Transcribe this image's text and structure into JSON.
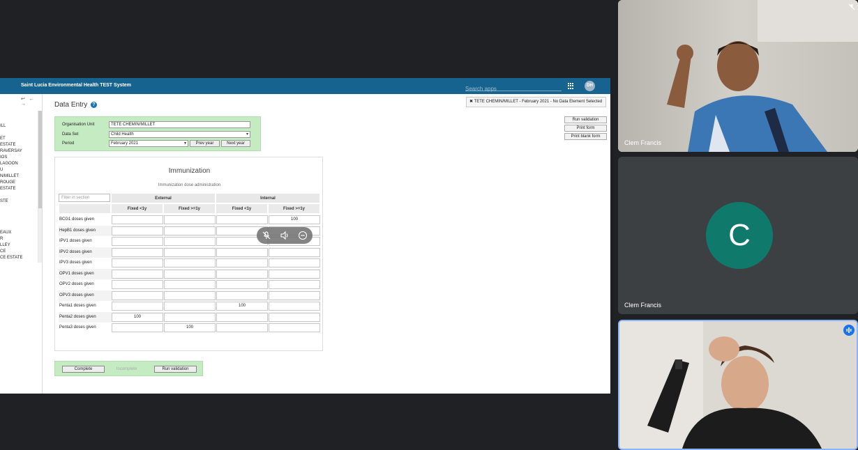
{
  "app": {
    "title": "Saint Lucia Environmental Health TEST System",
    "search_placeholder": "Search apps",
    "user_initials": "DH"
  },
  "tree": {
    "nav_arrows": "↩ ← →",
    "items": [
      "",
      "",
      "ILL",
      "",
      "ET",
      "ESTATE",
      "RAVERSAY",
      "IOS",
      "LAGOON",
      "U",
      "N/MILLET",
      "ROUGE",
      "ESTATE",
      "",
      "STE",
      "",
      "",
      "",
      "",
      "EAUX",
      "R",
      "LLEY",
      "CE",
      "CE ESTATE"
    ]
  },
  "page": {
    "title": "Data Entry",
    "help_glyph": "?",
    "selection_label": "✖ TETE CHEMIN/MILLET - February 2021 - No Data Element Selected"
  },
  "actions": {
    "run_validation": "Run validation",
    "print_form": "Print form",
    "print_blank_form": "Print blank form"
  },
  "org": {
    "org_unit_label": "Organisation Unit",
    "org_unit_value": "TETE CHEMIN/MILLET",
    "data_set_label": "Data Set",
    "data_set_value": "Child Health",
    "period_label": "Period",
    "period_value": "February 2021",
    "prev_year": "Prev year",
    "next_year": "Next year"
  },
  "section": {
    "title": "Immunization",
    "subtitle": "Immunization dose administration",
    "filter_placeholder": "Filter in section",
    "groups": [
      "External",
      "Internal"
    ],
    "columns": [
      "Fixed <1y",
      "Fixed >=1y",
      "Fixed <1y",
      "Fixed >=1y"
    ],
    "rows": [
      {
        "label": "BCG1 doses given",
        "values": [
          "",
          "",
          "",
          "100"
        ]
      },
      {
        "label": "HepB1 doses given",
        "values": [
          "",
          "",
          "",
          ""
        ]
      },
      {
        "label": "IPV1 doses given",
        "values": [
          "",
          "",
          "",
          ""
        ]
      },
      {
        "label": "IPV2 doses given",
        "values": [
          "",
          "",
          "",
          ""
        ]
      },
      {
        "label": "IPV3 doses given",
        "values": [
          "",
          "",
          "",
          ""
        ]
      },
      {
        "label": "OPV1 doses given",
        "values": [
          "",
          "",
          "",
          ""
        ]
      },
      {
        "label": "OPV2 doses given",
        "values": [
          "",
          "",
          "",
          ""
        ]
      },
      {
        "label": "OPV3 doses given",
        "values": [
          "",
          "",
          "",
          ""
        ]
      },
      {
        "label": "Penta1 doses given",
        "values": [
          "",
          "",
          "100",
          ""
        ]
      },
      {
        "label": "Penta2 doses given",
        "values": [
          "100",
          "",
          "",
          ""
        ]
      },
      {
        "label": "Penta3 doses given",
        "values": [
          "",
          "100",
          "",
          ""
        ]
      }
    ]
  },
  "completion": {
    "complete": "Complete",
    "incomplete": "Incomplete",
    "run_validation": "Run validation"
  },
  "participants": [
    {
      "name": "Clem Francis"
    },
    {
      "name": "Clem Francis",
      "initial": "C"
    },
    {
      "name": ""
    }
  ],
  "colors": {
    "topbar": "#17638f",
    "panel_green": "#c5ebc3",
    "avatar_teal": "#0f7a6b",
    "speaking_blue": "#1a73e8"
  }
}
